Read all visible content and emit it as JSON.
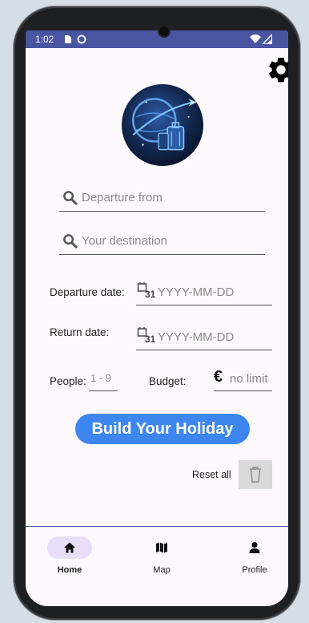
{
  "status": {
    "time": "1:02"
  },
  "search": {
    "departure_placeholder": "Departure from",
    "destination_placeholder": "Your destination"
  },
  "dates": {
    "departure_label": "Departure date:",
    "departure_placeholder": "YYYY-MM-DD",
    "return_label": "Return date:",
    "return_placeholder": "YYYY-MM-DD",
    "calendar_day": "31"
  },
  "people": {
    "label": "People:",
    "placeholder": "1 - 9"
  },
  "budget": {
    "label": "Budget:",
    "currency_symbol": "€",
    "placeholder": "no limit"
  },
  "actions": {
    "build_label": "Build Your Holiday",
    "reset_label": "Reset all"
  },
  "nav": [
    {
      "label": "Home",
      "icon": "home-icon",
      "active": true
    },
    {
      "label": "Map",
      "icon": "map-icon",
      "active": false
    },
    {
      "label": "Profile",
      "icon": "person-icon",
      "active": false
    }
  ],
  "colors": {
    "status_bar": "#4a55a2",
    "primary": "#3d86ef",
    "nav_active_pill": "#e9ddf8"
  }
}
